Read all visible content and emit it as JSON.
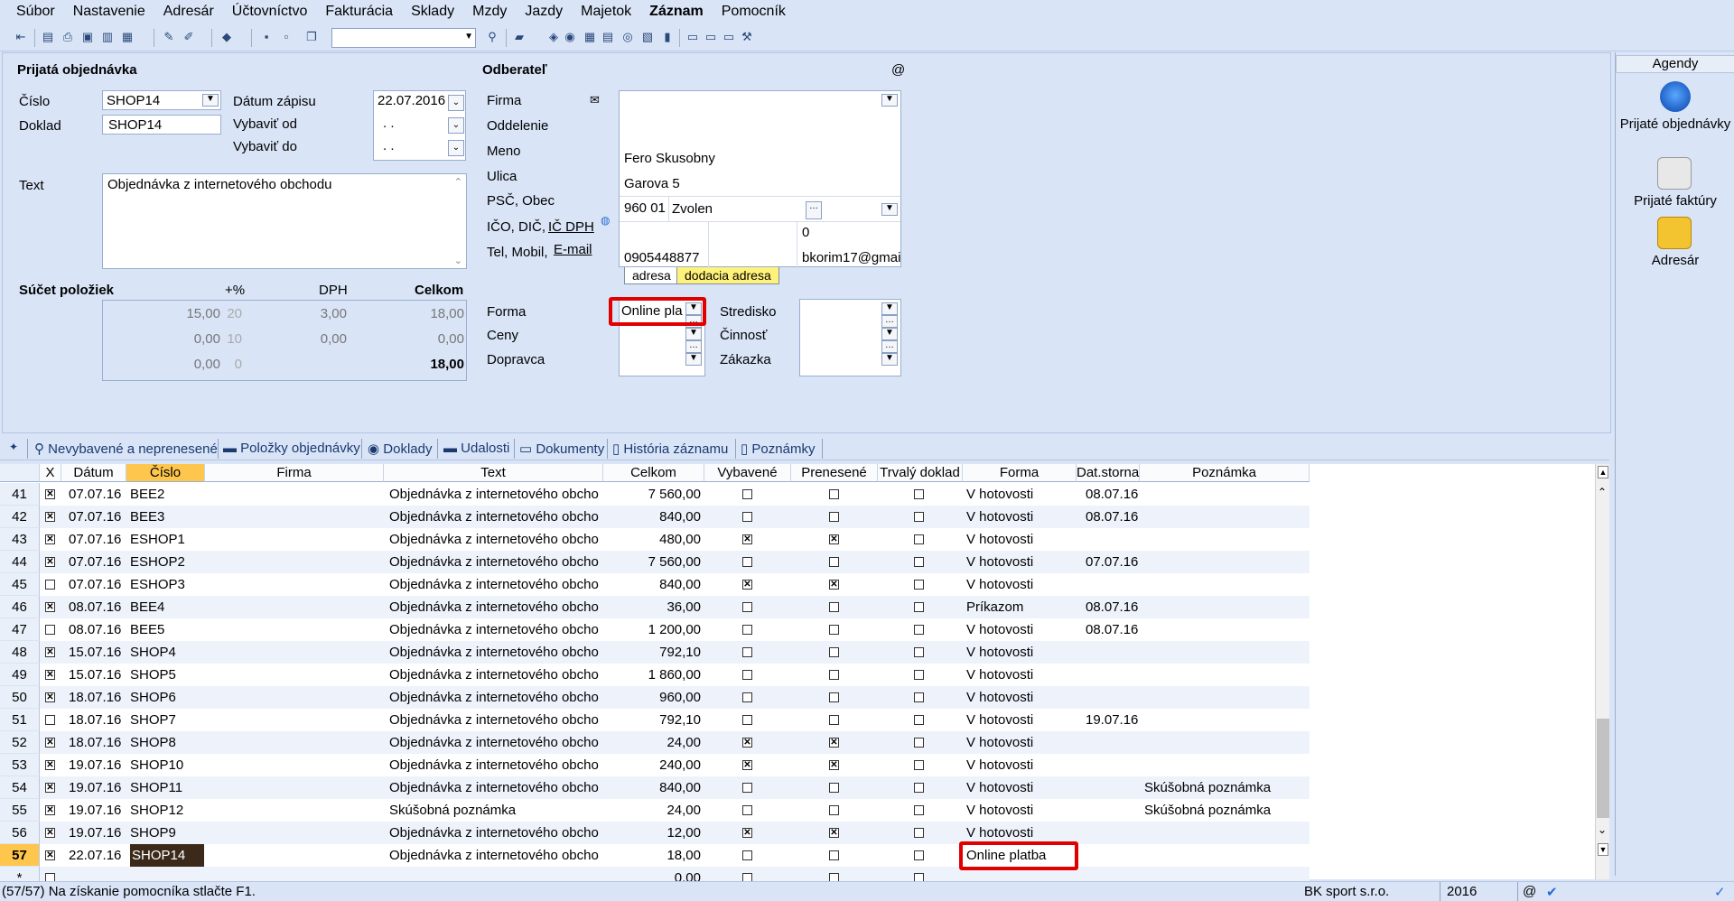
{
  "menu": [
    "Súbor",
    "Nastavenie",
    "Adresár",
    "Účtovníctvo",
    "Fakturácia",
    "Sklady",
    "Mzdy",
    "Jazdy",
    "Majetok",
    "Záznam",
    "Pomocník"
  ],
  "form": {
    "section_title": "Prijatá objednávka",
    "cislo_label": "Číslo",
    "cislo_value": "SHOP14",
    "doklad_label": "Doklad",
    "doklad_value": "SHOP14",
    "datum_zapisu_label": "Dátum zápisu",
    "datum_zapisu_value": "22.07.2016",
    "vybavit_od_label": "Vybaviť od",
    "vybavit_od_value": ". .",
    "vybavit_do_label": "Vybaviť do",
    "vybavit_do_value": ". .",
    "text_label": "Text",
    "text_value": "Objednávka z internetového obchodu",
    "sucet_label": "Súčet položiek",
    "col_pct": "+%",
    "col_dph": "DPH",
    "col_celkom": "Celkom",
    "sum_rows": [
      {
        "base": "15,00",
        "pct": "20",
        "dph": "3,00",
        "total": "18,00"
      },
      {
        "base": "0,00",
        "pct": "10",
        "dph": "0,00",
        "total": "0,00"
      },
      {
        "base": "0,00",
        "pct": "0",
        "dph": "",
        "total": "18,00"
      }
    ]
  },
  "odberatel": {
    "title": "Odberateľ",
    "at_sign": "@",
    "firma_label": "Firma",
    "oddelenie_label": "Oddelenie",
    "meno_label": "Meno",
    "meno_value": "Fero Skusobny",
    "ulica_label": "Ulica",
    "ulica_value": "Garova 5",
    "psc_label": "PSČ, Obec",
    "psc_value": "960 01",
    "obec_value": "Zvolen",
    "ico_label": "IČO, DIČ,",
    "icdph_label": "IČ DPH",
    "icdph_value": "0",
    "tel_label": "Tel, Mobil,",
    "email_label": "E-mail",
    "tel_value": "0905448877",
    "email_value": "bkorim17@gmai",
    "tab_adresa": "adresa",
    "tab_dodacia": "dodacia adresa",
    "forma_label": "Forma",
    "forma_value": "Online pla",
    "ceny_label": "Ceny",
    "dopravca_label": "Dopravca",
    "stredisko_label": "Stredisko",
    "cinnost_label": "Činnosť",
    "zakazka_label": "Zákazka"
  },
  "agendy": {
    "title": "Agendy",
    "items": [
      "Prijaté objednávky",
      "Prijaté faktúry",
      "Adresár"
    ]
  },
  "tabs": [
    "Nevybavené a neprenesené",
    "Položky objednávky",
    "Doklady",
    "Udalosti",
    "Dokumenty",
    "História záznamu",
    "Poznámky"
  ],
  "grid": {
    "headers": [
      "X",
      "Dátum",
      "Číslo",
      "Firma",
      "Text",
      "Celkom",
      "Vybavené",
      "Prenesené",
      "Trvalý doklad",
      "Forma",
      "Dat.storna",
      "Poznámka"
    ],
    "rows": [
      {
        "n": "41",
        "x": true,
        "d": "07.07.16",
        "c": "BEE2",
        "t": "Objednávka z internetového obcho",
        "s": "7 560,00",
        "v": false,
        "p": false,
        "tr": false,
        "f": "V hotovosti",
        "ds": "08.07.16",
        "pz": ""
      },
      {
        "n": "42",
        "x": true,
        "d": "07.07.16",
        "c": "BEE3",
        "t": "Objednávka z internetového obcho",
        "s": "840,00",
        "v": false,
        "p": false,
        "tr": false,
        "f": "V hotovosti",
        "ds": "08.07.16",
        "pz": ""
      },
      {
        "n": "43",
        "x": true,
        "d": "07.07.16",
        "c": "ESHOP1",
        "t": "Objednávka z internetového obcho",
        "s": "480,00",
        "v": true,
        "p": true,
        "tr": false,
        "f": "V hotovosti",
        "ds": "",
        "pz": ""
      },
      {
        "n": "44",
        "x": true,
        "d": "07.07.16",
        "c": "ESHOP2",
        "t": "Objednávka z internetového obcho",
        "s": "7 560,00",
        "v": false,
        "p": false,
        "tr": false,
        "f": "V hotovosti",
        "ds": "07.07.16",
        "pz": ""
      },
      {
        "n": "45",
        "x": false,
        "d": "07.07.16",
        "c": "ESHOP3",
        "t": "Objednávka z internetového obcho",
        "s": "840,00",
        "v": true,
        "p": true,
        "tr": false,
        "f": "V hotovosti",
        "ds": "",
        "pz": ""
      },
      {
        "n": "46",
        "x": true,
        "d": "08.07.16",
        "c": "BEE4",
        "t": "Objednávka z internetového obcho",
        "s": "36,00",
        "v": false,
        "p": false,
        "tr": false,
        "f": "Príkazom",
        "ds": "08.07.16",
        "pz": ""
      },
      {
        "n": "47",
        "x": false,
        "d": "08.07.16",
        "c": "BEE5",
        "t": "Objednávka z internetového obcho",
        "s": "1 200,00",
        "v": false,
        "p": false,
        "tr": false,
        "f": "V hotovosti",
        "ds": "08.07.16",
        "pz": ""
      },
      {
        "n": "48",
        "x": true,
        "d": "15.07.16",
        "c": "SHOP4",
        "t": "Objednávka z internetového obcho",
        "s": "792,10",
        "v": false,
        "p": false,
        "tr": false,
        "f": "V hotovosti",
        "ds": "",
        "pz": ""
      },
      {
        "n": "49",
        "x": true,
        "d": "15.07.16",
        "c": "SHOP5",
        "t": "Objednávka z internetového obcho",
        "s": "1 860,00",
        "v": false,
        "p": false,
        "tr": false,
        "f": "V hotovosti",
        "ds": "",
        "pz": ""
      },
      {
        "n": "50",
        "x": true,
        "d": "18.07.16",
        "c": "SHOP6",
        "t": "Objednávka z internetového obcho",
        "s": "960,00",
        "v": false,
        "p": false,
        "tr": false,
        "f": "V hotovosti",
        "ds": "",
        "pz": ""
      },
      {
        "n": "51",
        "x": false,
        "d": "18.07.16",
        "c": "SHOP7",
        "t": "Objednávka z internetového obcho",
        "s": "792,10",
        "v": false,
        "p": false,
        "tr": false,
        "f": "V hotovosti",
        "ds": "19.07.16",
        "pz": ""
      },
      {
        "n": "52",
        "x": true,
        "d": "18.07.16",
        "c": "SHOP8",
        "t": "Objednávka z internetového obcho",
        "s": "24,00",
        "v": true,
        "p": true,
        "tr": false,
        "f": "V hotovosti",
        "ds": "",
        "pz": ""
      },
      {
        "n": "53",
        "x": true,
        "d": "19.07.16",
        "c": "SHOP10",
        "t": "Objednávka z internetového obcho",
        "s": "240,00",
        "v": true,
        "p": true,
        "tr": false,
        "f": "V hotovosti",
        "ds": "",
        "pz": ""
      },
      {
        "n": "54",
        "x": true,
        "d": "19.07.16",
        "c": "SHOP11",
        "t": "Objednávka z internetového obcho",
        "s": "840,00",
        "v": false,
        "p": false,
        "tr": false,
        "f": "V hotovosti",
        "ds": "",
        "pz": "Skúšobná poznámka"
      },
      {
        "n": "55",
        "x": true,
        "d": "19.07.16",
        "c": "SHOP12",
        "t": "Skúšobná poznámka",
        "s": "24,00",
        "v": false,
        "p": false,
        "tr": false,
        "f": "V hotovosti",
        "ds": "",
        "pz": "Skúšobná poznámka"
      },
      {
        "n": "56",
        "x": true,
        "d": "19.07.16",
        "c": "SHOP9",
        "t": "Objednávka z internetového obcho",
        "s": "12,00",
        "v": true,
        "p": true,
        "tr": false,
        "f": "V hotovosti",
        "ds": "",
        "pz": ""
      },
      {
        "n": "57",
        "x": true,
        "d": "22.07.16",
        "c": "SHOP14",
        "t": "Objednávka z internetového obcho",
        "s": "18,00",
        "v": false,
        "p": false,
        "tr": false,
        "f": "Online platba",
        "ds": "",
        "pz": ""
      },
      {
        "n": "*",
        "x": false,
        "d": "",
        "c": "",
        "t": "",
        "s": "0,00",
        "v": false,
        "p": false,
        "tr": false,
        "f": "",
        "ds": "",
        "pz": ""
      }
    ]
  },
  "status": {
    "text": "(57/57) Na získanie pomocníka stlačte F1.",
    "company": "BK sport  s.r.o.",
    "year": "2016",
    "at": "@"
  }
}
